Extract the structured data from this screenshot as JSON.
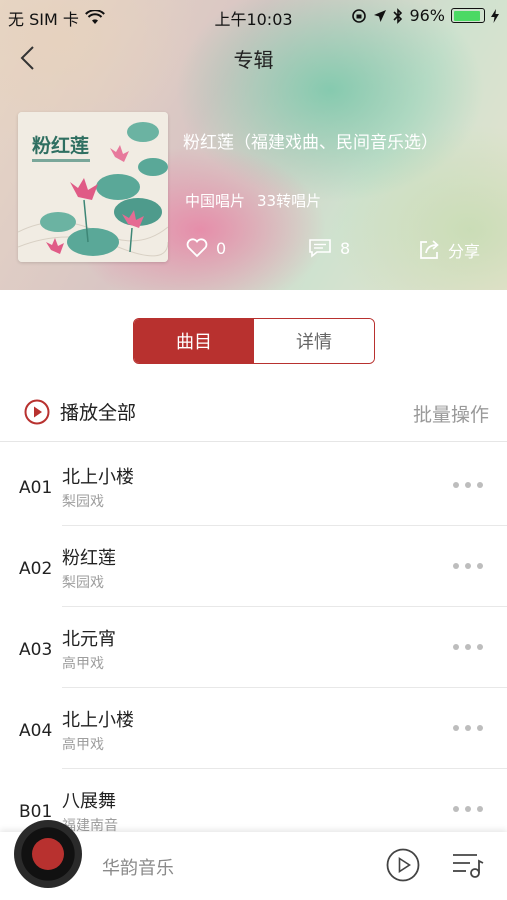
{
  "status_bar": {
    "carrier": "无 SIM 卡",
    "time": "上午10:03",
    "battery_percent": "96%",
    "battery_level": 0.96
  },
  "nav": {
    "title": "专辑"
  },
  "album": {
    "cover_text": "粉红莲",
    "title": "粉红莲（福建戏曲、民间音乐选）",
    "label": "中国唱片",
    "format": "33转唱片",
    "likes": "0",
    "comments": "8",
    "share_label": "分享"
  },
  "tabs": [
    {
      "label": "曲目",
      "active": true
    },
    {
      "label": "详情",
      "active": false
    }
  ],
  "list_header": {
    "play_all": "播放全部",
    "batch": "批量操作"
  },
  "tracks": [
    {
      "no": "A01",
      "name": "北上小楼",
      "genre": "梨园戏"
    },
    {
      "no": "A02",
      "name": "粉红莲",
      "genre": "梨园戏"
    },
    {
      "no": "A03",
      "name": "北元宵",
      "genre": "高甲戏"
    },
    {
      "no": "A04",
      "name": "北上小楼",
      "genre": "高甲戏"
    },
    {
      "no": "B01",
      "name": "八展舞",
      "genre": "福建南音"
    }
  ],
  "player": {
    "name": "华韵音乐"
  },
  "colors": {
    "accent": "#b8312f",
    "battery": "#4cd964"
  }
}
